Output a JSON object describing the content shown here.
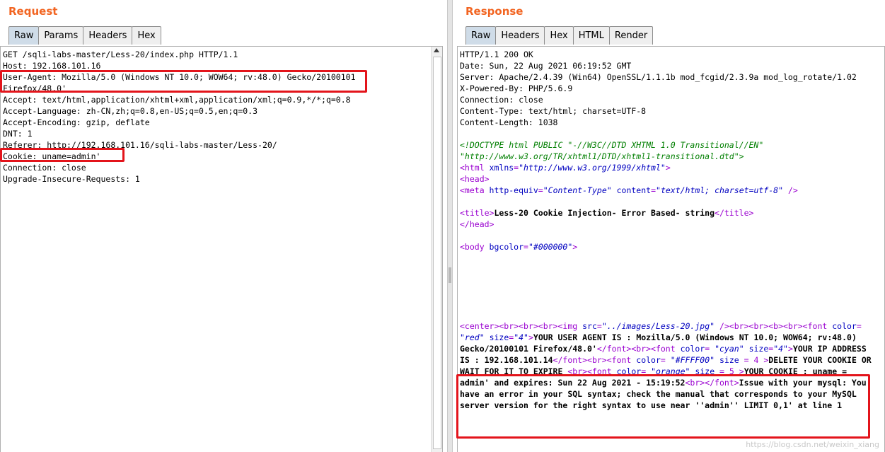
{
  "request": {
    "title": "Request",
    "tabs": [
      "Raw",
      "Params",
      "Headers",
      "Hex"
    ],
    "lines": [
      "GET /sqli-labs-master/Less-20/index.php HTTP/1.1",
      "Host: 192.168.101.16",
      "User-Agent: Mozilla/5.0 (Windows NT 10.0; WOW64; rv:48.0) Gecko/20100101",
      "Firefox/48.0'",
      "Accept: text/html,application/xhtml+xml,application/xml;q=0.9,*/*;q=0.8",
      "Accept-Language: zh-CN,zh;q=0.8,en-US;q=0.5,en;q=0.3",
      "Accept-Encoding: gzip, deflate",
      "DNT: 1",
      "Referer: http://192.168.101.16/sqli-labs-master/Less-20/",
      "Cookie: uname=admin'",
      "Connection: close",
      "Upgrade-Insecure-Requests: 1"
    ]
  },
  "response": {
    "title": "Response",
    "tabs": [
      "Raw",
      "Headers",
      "Hex",
      "HTML",
      "Render"
    ],
    "headers": [
      "HTTP/1.1 200 OK",
      "Date: Sun, 22 Aug 2021 06:19:52 GMT",
      "Server: Apache/2.4.39 (Win64) OpenSSL/1.1.1b mod_fcgid/2.3.9a mod_log_rotate/1.02",
      "X-Powered-By: PHP/5.6.9",
      "Connection: close",
      "Content-Type: text/html; charset=UTF-8",
      "Content-Length: 1038"
    ],
    "doctype_1": "<!DOCTYPE html PUBLIC \"-//W3C//DTD XHTML 1.0 Transitional//EN\"",
    "doctype_2": "\"http://www.w3.org/TR/xhtml1/DTD/xhtml1-transitional.dtd\">",
    "html_tag": "<html ",
    "html_attr": "xmlns",
    "html_eq": "=",
    "html_val": "\"http://www.w3.org/1999/xhtml\"",
    "html_close": ">",
    "head_tag": "<head>",
    "meta_tag": "<meta ",
    "meta_attr1": "http-equiv",
    "meta_val1": "\"Content-Type\"",
    "meta_attr2": "content",
    "meta_val2": "\"text/html; charset=utf-8\"",
    "meta_close": " />",
    "title_open": "<title>",
    "title_text": "Less-20 Cookie Injection- Error Based- string",
    "title_close": "</title>",
    "head_close": "</head>",
    "body_tag": "<body ",
    "body_attr": "bgcolor",
    "body_val": "\"#000000\"",
    "body_close": ">",
    "output": {
      "c1": "<center><br><br><br><img ",
      "src_attr": "src",
      "src_val": "\"../images/Less-20.jpg\"",
      "c2": " /><br><br><b><br><font ",
      "color_attr": "color",
      "red_val": "\"red\"",
      "size_attr": "size",
      "size4_val": "\"4\"",
      "c3": ">",
      "ua_text": "YOUR USER AGENT IS : Mozilla/5.0 (Windows NT 10.0; WOW64; rv:48.0) Gecko/20100101 Firefox/48.0'",
      "c4": "</font><br><font ",
      "cyan_val": "\"cyan\"",
      "ip_text": "YOUR IP ADDRESS IS : 192.168.101.14",
      "c5": "</font><br><font ",
      "ffff_val": "\"#FFFF00\"",
      "size_eq4": " = 4 ",
      "delete_text": "DELETE YOUR COOKIE OR WAIT FOR IT TO EXPIRE",
      "c6": "<br><font ",
      "orange_val": "\"orange\"",
      "size_eq5": " = 5 ",
      "cookie_text": "YOUR COOKIE : uname = admin' and expires: Sun 22 Aug 2021 - 15:19:52",
      "c7": "<br></font>",
      "error_text": "Issue with your mysql: You have an error in your SQL syntax; check the manual that corresponds to your MySQL server version for the right syntax to use near ''admin'' LIMIT 0,1' at line 1"
    }
  },
  "watermark": "https://blog.csdn.net/weixin_xiang"
}
